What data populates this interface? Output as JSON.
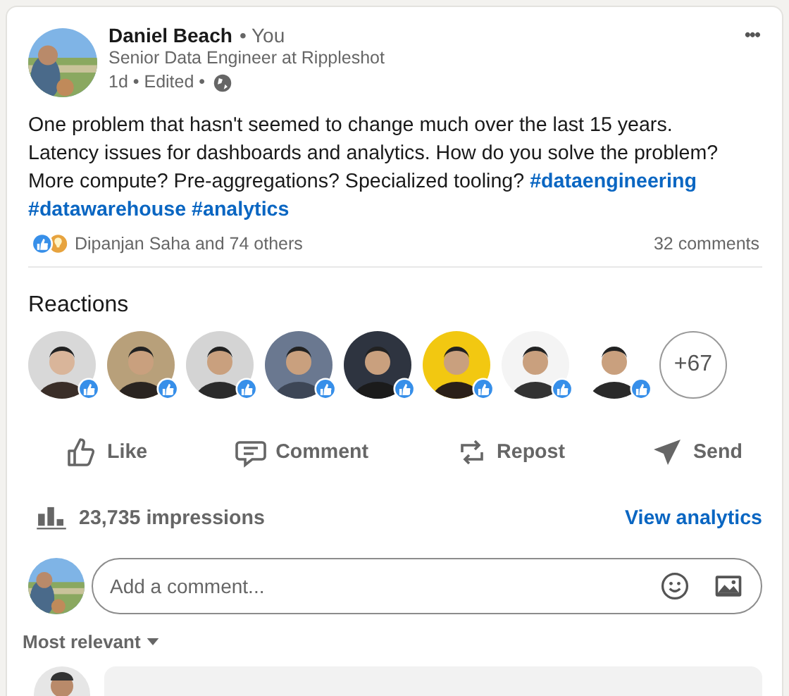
{
  "post": {
    "author": "Daniel Beach",
    "relation": "• You",
    "headline": "Senior Data Engineer at Rippleshot",
    "meta": "1d • Edited •",
    "more": "•••",
    "body_lines": [
      [
        {
          "kind": "text",
          "text": "One problem that hasn't seemed to change much over the last 15 years."
        }
      ],
      [
        {
          "kind": "text",
          "text": "Latency issues for dashboards and analytics. How do you solve the problem?"
        }
      ],
      [
        {
          "kind": "text",
          "text": "More compute? Pre-aggregations? Specialized tooling? "
        },
        {
          "kind": "hashtag",
          "text": "#dataengineering"
        }
      ],
      [
        {
          "kind": "hashtag",
          "text": "#datawarehouse"
        },
        {
          "kind": "hashtag",
          "text": "#analytics"
        }
      ]
    ],
    "reactions_summary": "Dipanjan Saha and 74 others",
    "comments_count": "32 comments"
  },
  "reactions": {
    "heading": "Reactions",
    "more": "+67"
  },
  "actions": [
    {
      "kind": "like",
      "label": "Like"
    },
    {
      "kind": "comment",
      "label": "Comment"
    },
    {
      "kind": "repost",
      "label": "Repost"
    },
    {
      "kind": "send",
      "label": "Send"
    }
  ],
  "impressions": "23,735 impressions",
  "analytics_link": "View analytics",
  "comment_box": {
    "placeholder": "Add a comment..."
  },
  "sort": "Most relevant"
}
